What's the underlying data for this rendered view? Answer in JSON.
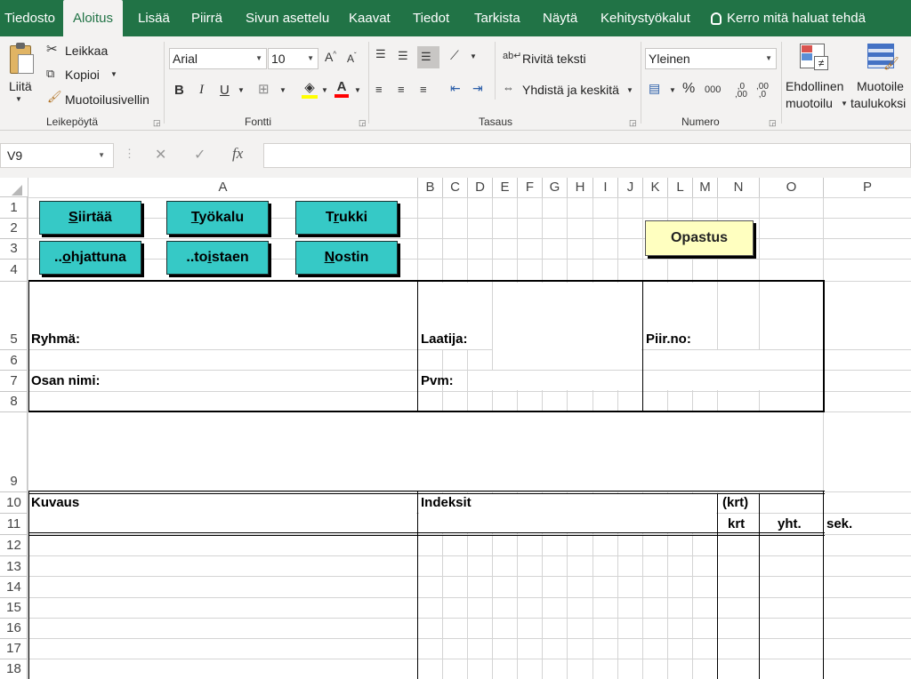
{
  "tabs": [
    "Tiedosto",
    "Aloitus",
    "Lisää",
    "Piirrä",
    "Sivun asettelu",
    "Kaavat",
    "Tiedot",
    "Tarkista",
    "Näytä",
    "Kehitystyökalut"
  ],
  "tell_me": "Kerro mitä haluat tehdä",
  "clipboard": {
    "paste": "Liitä",
    "cut": "Leikkaa",
    "copy": "Kopioi",
    "format_painter": "Muotoilusivellin",
    "group": "Leikepöytä"
  },
  "font": {
    "name": "Arial",
    "size": "10",
    "bold": "B",
    "italic": "I",
    "underline": "U",
    "group": "Fontti"
  },
  "alignment": {
    "wrap": "Rivitä teksti",
    "merge": "Yhdistä ja keskitä",
    "group": "Tasaus"
  },
  "number": {
    "format": "Yleinen",
    "percent": "%",
    "thousands": "000",
    "group": "Numero"
  },
  "styles": {
    "conditional_line1": "Ehdollinen",
    "conditional_line2": "muotoilu",
    "table_line1": "Muotoile",
    "table_line2": "taulukoksi"
  },
  "formula_bar": {
    "name_box": "V9",
    "fx": "fx",
    "cancel": "✕",
    "confirm": "✓",
    "value": ""
  },
  "columns": [
    "A",
    "B",
    "C",
    "D",
    "E",
    "F",
    "G",
    "H",
    "I",
    "J",
    "K",
    "L",
    "M",
    "N",
    "O",
    "P"
  ],
  "rows": [
    "1",
    "2",
    "3",
    "4",
    "5",
    "6",
    "7",
    "8",
    "9",
    "10",
    "11",
    "12",
    "13",
    "14",
    "15",
    "16",
    "17",
    "18"
  ],
  "macro_buttons": {
    "siirtaa": {
      "u": "S",
      "rest": "iirtää"
    },
    "tyokalu": {
      "u": "T",
      "rest": "yökalu"
    },
    "trukki": {
      "pre": "T",
      "u": "r",
      "rest": "ukki"
    },
    "ohjattuna": {
      "pre": "..",
      "u": "o",
      "rest": "hjattuna"
    },
    "toistaen": {
      "pre": "..to",
      "u": "i",
      "rest": "staen"
    },
    "nostin": {
      "u": "N",
      "rest": "ostin"
    }
  },
  "opastus": "Opastus",
  "cells": {
    "ryhma": "Ryhmä:",
    "laatija": "Laatija:",
    "piirno": "Piir.no:",
    "osan_nimi": "Osan nimi:",
    "pvm": "Pvm:",
    "kuvaus": "Kuvaus",
    "indeksit": "Indeksit",
    "krt_paren": "(krt)",
    "krt": "krt",
    "yht": "yht.",
    "sek": "sek."
  }
}
